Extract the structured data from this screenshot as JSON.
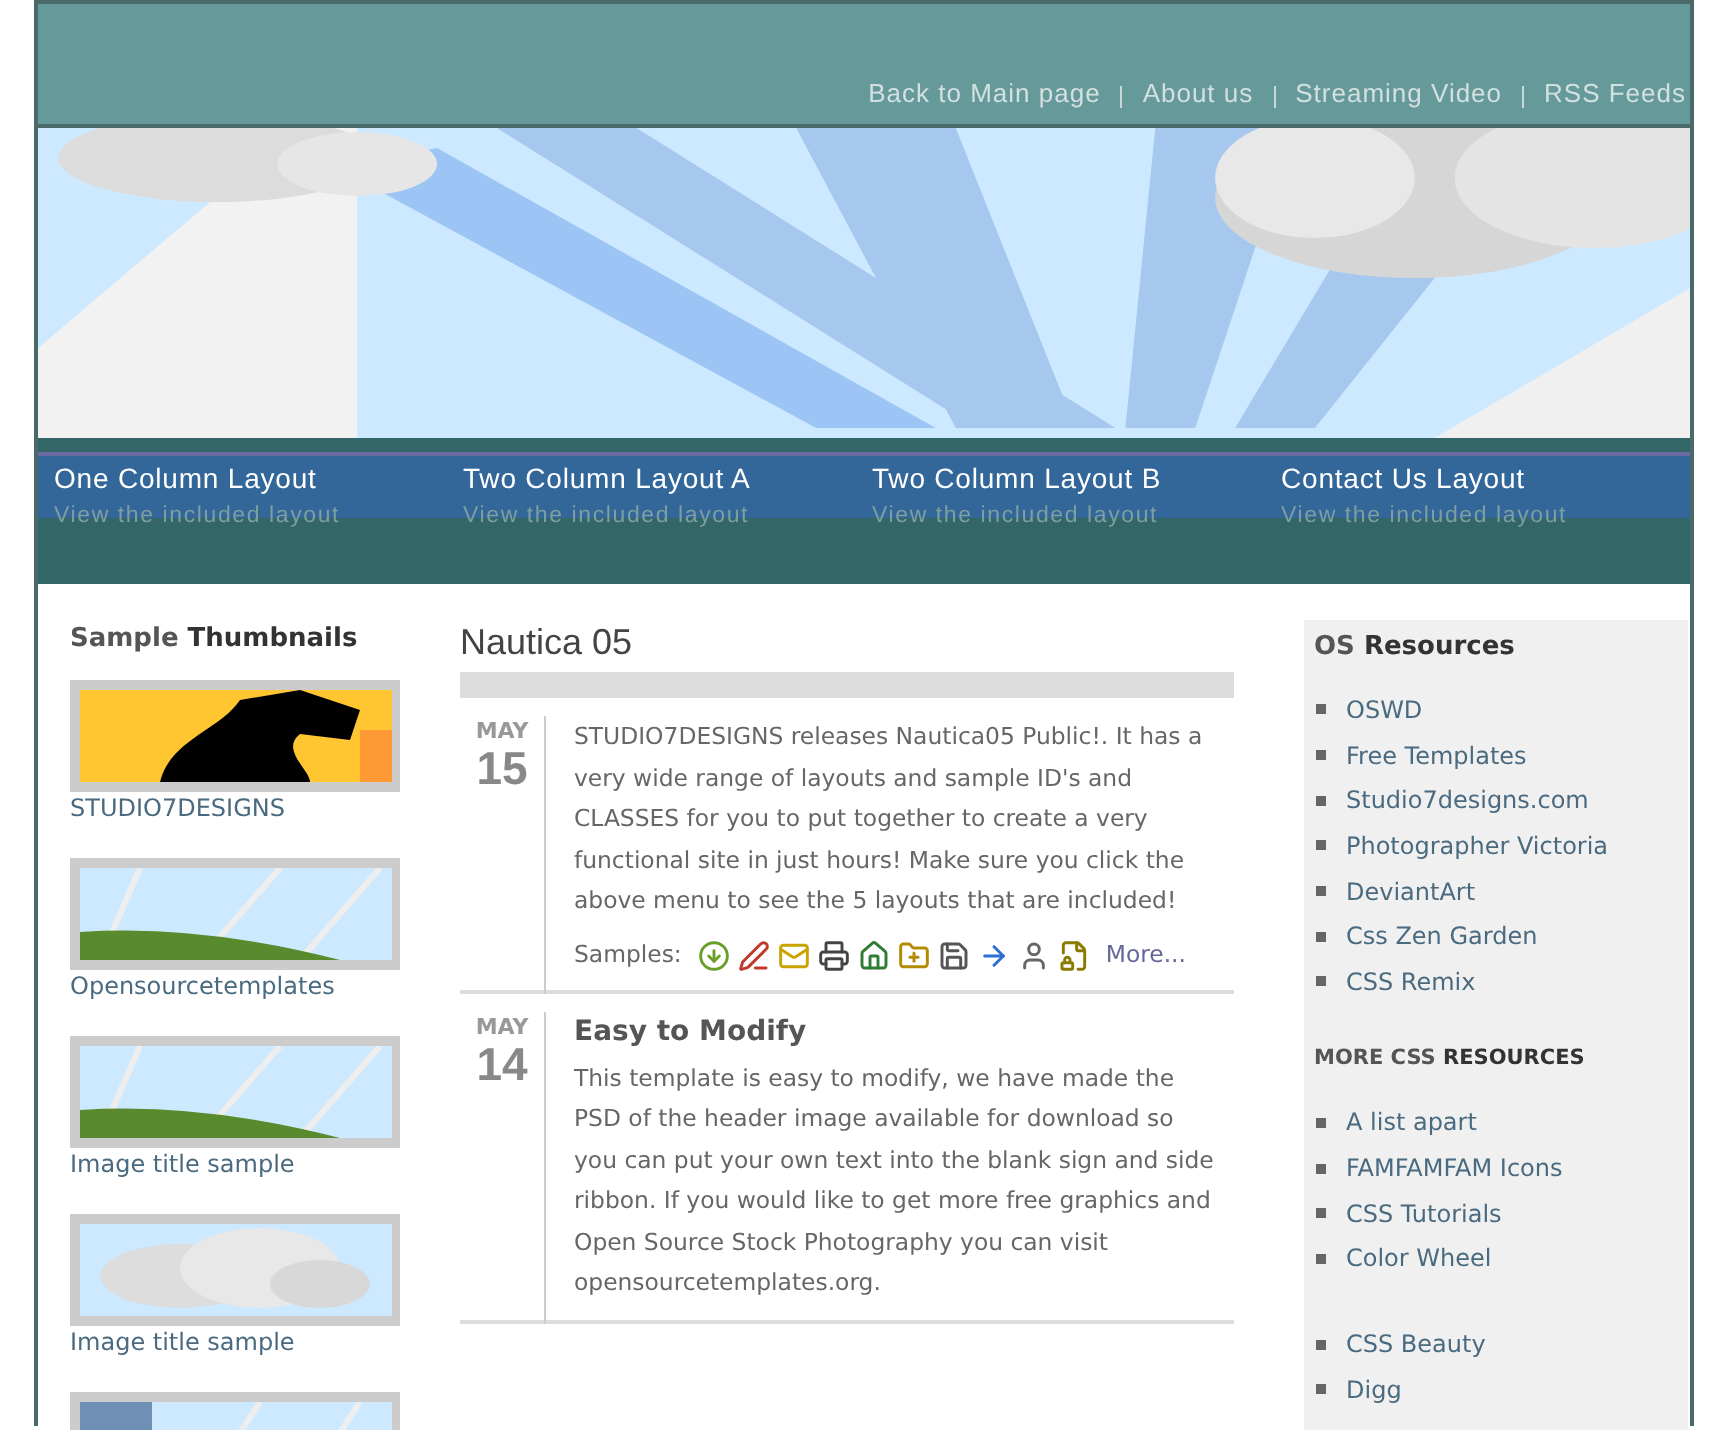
{
  "top_nav": [
    "Back to Main page",
    "About us",
    "Streaming Video",
    "RSS Feeds"
  ],
  "layout_menu": [
    {
      "title": "One Column Layout",
      "subtitle": "View the included layout"
    },
    {
      "title": "Two Column Layout A",
      "subtitle": "View the included layout"
    },
    {
      "title": "Two Column Layout B",
      "subtitle": "View the included layout"
    },
    {
      "title": "Contact Us Layout",
      "subtitle": "View the included layout"
    }
  ],
  "thumbnails": {
    "title_light": "Sample",
    "title_dark": "Thumbnails",
    "items": [
      {
        "kind": "picture",
        "caption": "STUDIO7DESIGNS"
      },
      {
        "kind": "picture",
        "caption": "Opensourcetemplates"
      },
      {
        "kind": "picture",
        "caption": "Image title sample"
      },
      {
        "kind": "picture",
        "caption": "Image title sample"
      },
      {
        "kind": "picture"
      }
    ]
  },
  "main": {
    "title": "Nautica 05",
    "posts": [
      {
        "month": "MAY",
        "day": "15",
        "body": "STUDIO7DESIGNS releases Nautica05 Public!. It has a very wide range of layouts and sample ID's and CLASSES for you to put together to create a very functional site in just hours! Make sure you click the above menu to see the 5 layouts that are included!",
        "samples_label": "Samples:",
        "more": "More..."
      },
      {
        "month": "MAY",
        "day": "14",
        "heading": "Easy to Modify",
        "body": "This template is easy to modify, we have made the PSD of the header image available for download so you can put your own text into the blank sign and side ribbon. If you would like to get more free graphics and Open Source Stock Photography you can visit opensourcetemplates.org."
      }
    ]
  },
  "sidebar": {
    "sections": [
      {
        "title_light": "OS",
        "title_dark": "Resources",
        "small_caps": false,
        "links": [
          "OSWD",
          "Free Templates",
          "Studio7designs.com",
          "Photographer Victoria",
          "DeviantArt",
          "Css Zen Garden",
          "CSS Remix"
        ]
      },
      {
        "title_light": "MORE CSS",
        "title_dark": "RESOURCES",
        "small_caps": true,
        "links": [
          "A list apart",
          "FAMFAMFAM Icons",
          "CSS Tutorials",
          "Color Wheel"
        ]
      },
      {
        "links": [
          "CSS Beauty",
          "Digg"
        ]
      }
    ]
  }
}
